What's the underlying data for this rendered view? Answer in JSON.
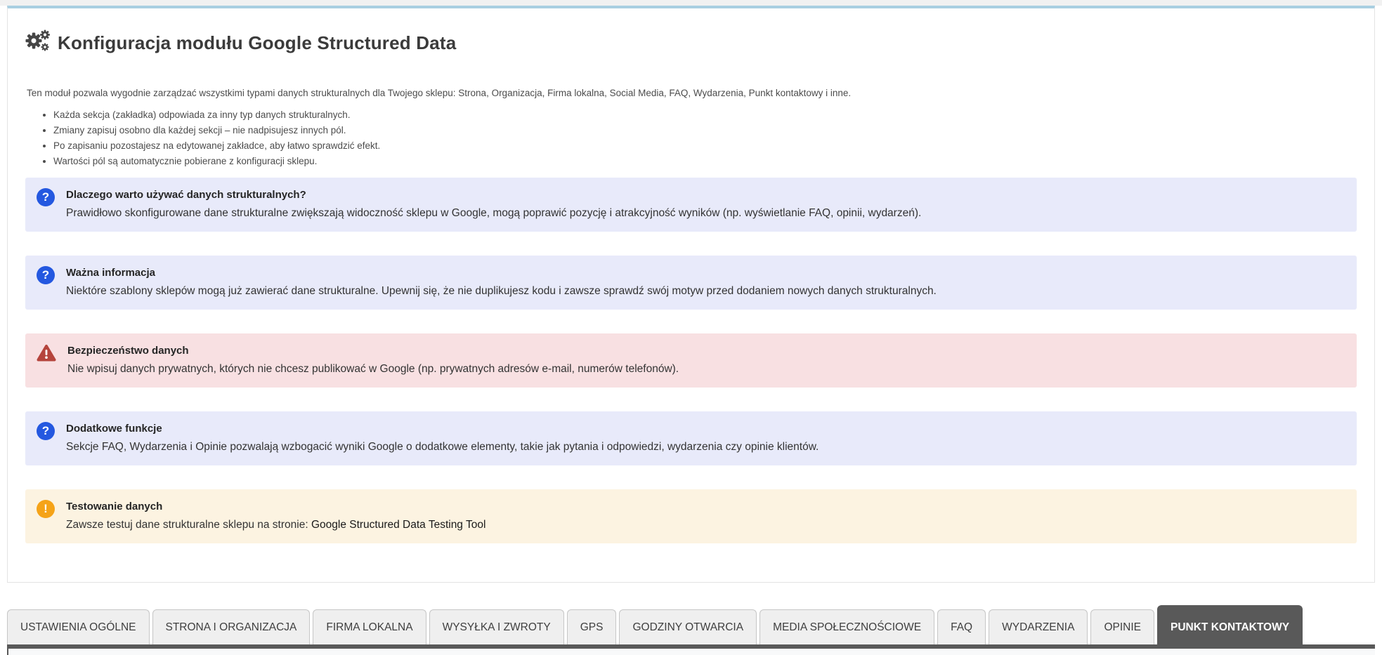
{
  "header": {
    "title": "Konfiguracja modułu Google Structured Data",
    "icon": "gears-icon"
  },
  "intro": {
    "text": "Ten moduł pozwala wygodnie zarządzać wszystkimi typami danych strukturalnych dla Twojego sklepu: Strona, Organizacja, Firma lokalna, Social Media, FAQ, Wydarzenia, Punkt kontaktowy i inne."
  },
  "notes": [
    "Każda sekcja (zakładka) odpowiada za inny typ danych strukturalnych.",
    "Zmiany zapisuj osobno dla każdej sekcji – nie nadpisujesz innych pól.",
    "Po zapisaniu pozostajesz na edytowanej zakładce, aby łatwo sprawdzić efekt.",
    "Wartości pól są automatycznie pobierane z konfiguracji sklepu."
  ],
  "alerts": [
    {
      "type": "info",
      "icon": "question-circle-icon",
      "title": "Dlaczego warto używać danych strukturalnych?",
      "text": "Prawidłowo skonfigurowane dane strukturalne zwiększają widoczność sklepu w Google, mogą poprawić pozycję i atrakcyjność wyników (np. wyświetlanie FAQ, opinii, wydarzeń)."
    },
    {
      "type": "info",
      "icon": "question-circle-icon",
      "title": "Ważna informacja",
      "text": "Niektóre szablony sklepów mogą już zawierać dane strukturalne. Upewnij się, że nie duplikujesz kodu i zawsze sprawdź swój motyw przed dodaniem nowych danych strukturalnych."
    },
    {
      "type": "danger",
      "icon": "warning-triangle-icon",
      "title": "Bezpieczeństwo danych",
      "text": "Nie wpisuj danych prywatnych, których nie chcesz publikować w Google (np. prywatnych adresów e-mail, numerów telefonów)."
    },
    {
      "type": "info",
      "icon": "question-circle-icon",
      "title": "Dodatkowe funkcje",
      "text": "Sekcje FAQ, Wydarzenia i Opinie pozwalają wzbogacić wyniki Google o dodatkowe elementy, takie jak pytania i odpowiedzi, wydarzenia czy opinie klientów."
    },
    {
      "type": "warning",
      "icon": "exclamation-circle-icon",
      "title": "Testowanie danych",
      "text": "Zawsze testuj dane strukturalne sklepu na stronie:",
      "link_label": "Google Structured Data Testing Tool"
    }
  ],
  "tabs": [
    {
      "label": "USTAWIENIA OGÓLNE",
      "active": false
    },
    {
      "label": "STRONA I ORGANIZACJA",
      "active": false
    },
    {
      "label": "FIRMA LOKALNA",
      "active": false
    },
    {
      "label": "WYSYŁKA I ZWROTY",
      "active": false
    },
    {
      "label": "GPS",
      "active": false
    },
    {
      "label": "GODZINY OTWARCIA",
      "active": false
    },
    {
      "label": "MEDIA SPOŁECZNOŚCIOWE",
      "active": false
    },
    {
      "label": "FAQ",
      "active": false
    },
    {
      "label": "WYDARZENIA",
      "active": false
    },
    {
      "label": "OPINIE",
      "active": false
    },
    {
      "label": "PUNKT KONTAKTOWY",
      "active": true
    }
  ],
  "colors": {
    "panel_top_border": "#a9cfe1",
    "info_bg": "#e8eafa",
    "danger_bg": "#f8e0e2",
    "warning_bg": "#fcf3e1",
    "icon_blue": "#2458e0",
    "icon_red": "#b5443c",
    "icon_orange": "#f5a318",
    "tab_active_bg": "#595959"
  }
}
